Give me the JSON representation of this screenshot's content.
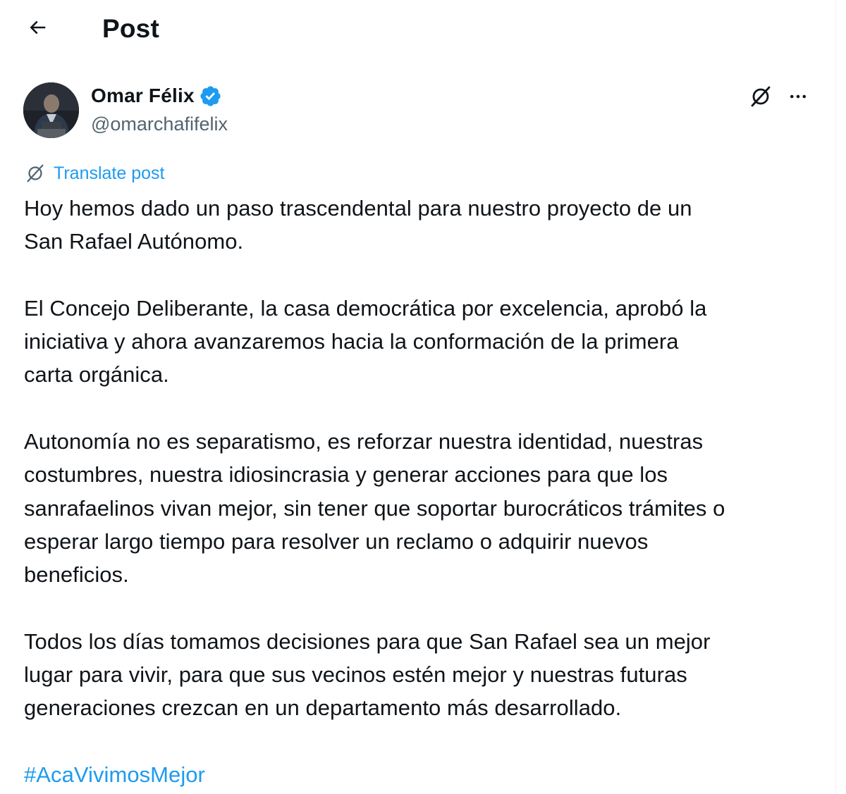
{
  "header": {
    "back_icon": "arrow-left-icon",
    "title": "Post"
  },
  "author": {
    "avatar": "avatar",
    "name": "Omar Félix",
    "verified_icon": "verified-badge-icon",
    "handle": "@omarchafifelix"
  },
  "actions": {
    "grok_icon": "grok-icon",
    "more_icon": "more-icon"
  },
  "translate": {
    "icon": "grok-icon",
    "label": "Translate post"
  },
  "post": {
    "paragraphs": [
      "Hoy hemos dado un paso trascendental para nuestro proyecto de un\nSan Rafael Autónomo.",
      "El Concejo Deliberante, la casa democrática por excelencia, aprobó la\niniciativa y ahora avanzaremos hacia la conformación de la primera\ncarta orgánica.",
      "Autonomía no es separatismo, es reforzar nuestra identidad, nuestras\ncostumbres, nuestra idiosincrasia y generar acciones para que los\nsanrafaelinos vivan mejor, sin tener que soportar burocráticos trámites o\nesperar largo tiempo para resolver un reclamo o adquirir nuevos\nbeneficios.",
      "Todos los días tomamos decisiones para que San Rafael sea un mejor\nlugar para vivir, para que sus vecinos estén mejor y nuestras futuras\ngeneraciones crezcan en un departamento más desarrollado."
    ],
    "hashtag": "#AcaVivimosMejor"
  },
  "colors": {
    "accent": "#1d9bf0",
    "text": "#0f1419",
    "secondary": "#536471"
  }
}
